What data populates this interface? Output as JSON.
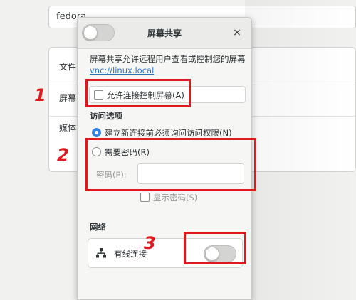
{
  "background": {
    "hostname": "fedora",
    "rows": [
      "文件",
      "屏幕",
      "媒体"
    ]
  },
  "dialog": {
    "title": "屏幕共享",
    "close": "×",
    "description": "屏幕共享允许远程用户查看或控制您的屏幕",
    "link": "vnc://linux.local",
    "allow_control_label": "允许连接控制屏幕(A)",
    "access_section": "访问选项",
    "new_connection_label": "建立新连接前必须询问访问权限(N)",
    "require_password_label": "需要密码(R)",
    "password_label": "密码(P):",
    "password_value": "",
    "show_password_label": "显示密码(S)",
    "network_section": "网络",
    "wired_label": "有线连接"
  },
  "annotations": [
    "1",
    "2",
    "3"
  ],
  "colors": {
    "accent": "#3584e4",
    "annotation_red": "#e0191f"
  }
}
